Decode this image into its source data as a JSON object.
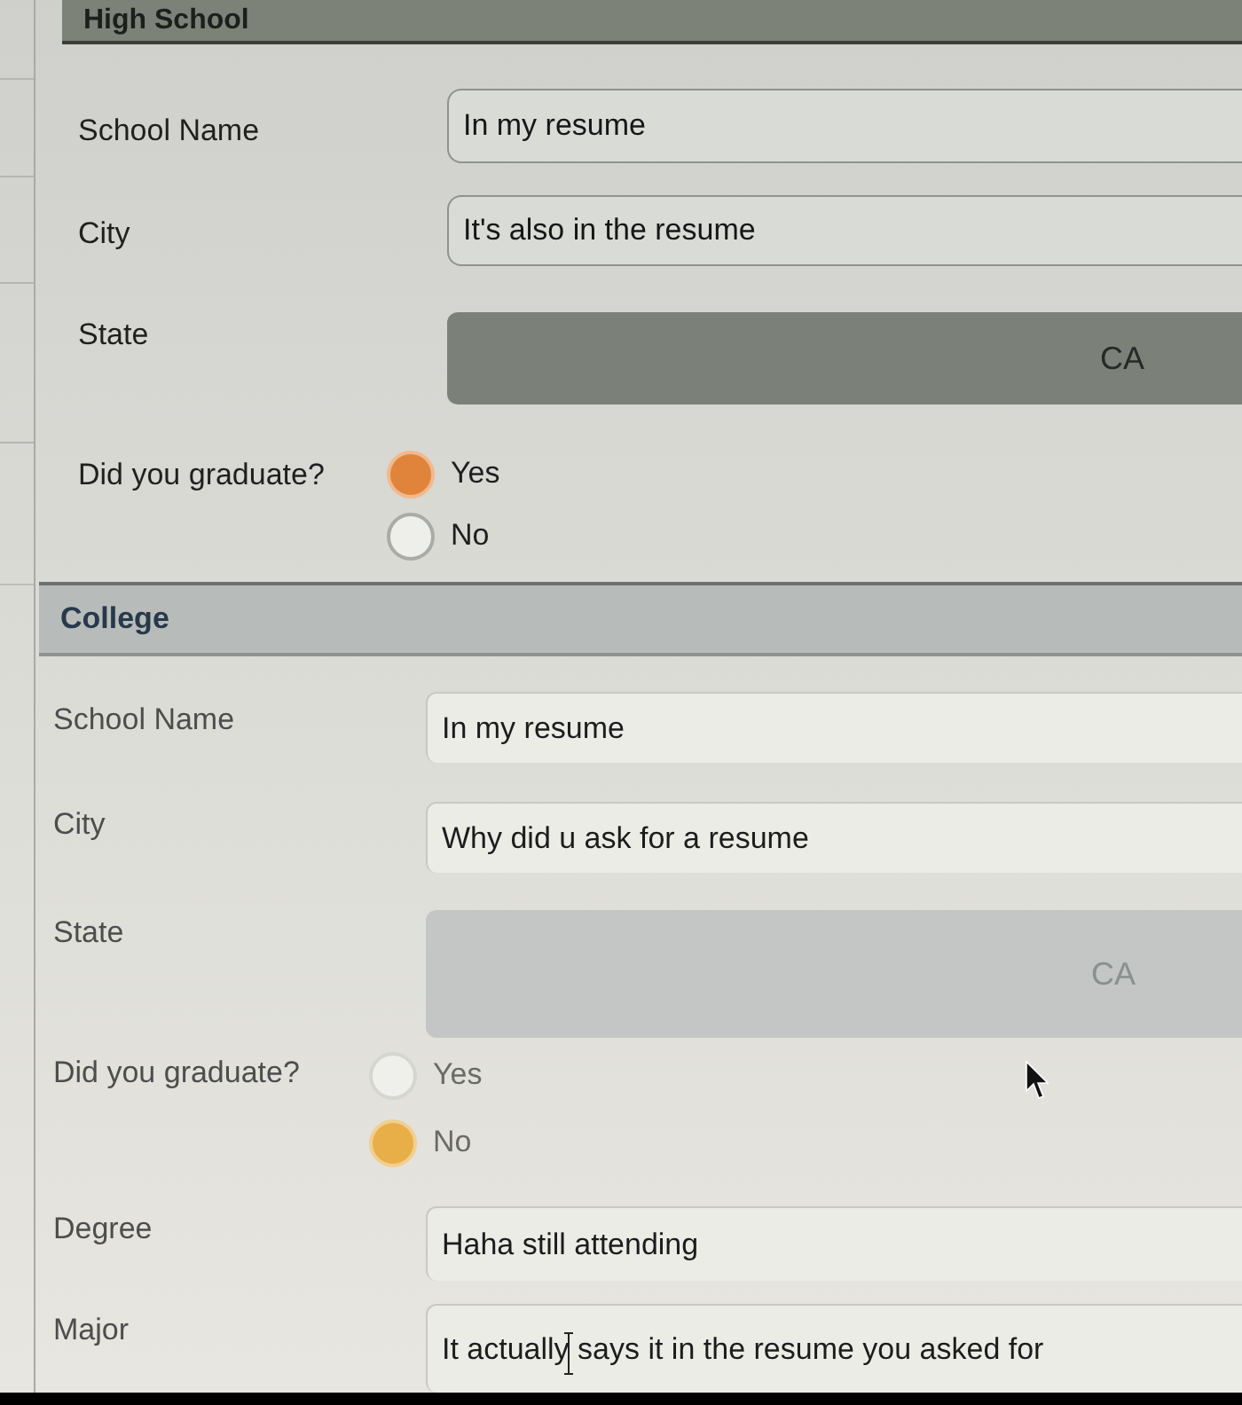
{
  "sections": [
    {
      "title": "High School",
      "fields": [
        {
          "kind": "text",
          "label": "School Name",
          "value": "In my resume"
        },
        {
          "kind": "text",
          "label": "City",
          "value": "It's also in the resume"
        },
        {
          "kind": "select",
          "label": "State",
          "value": "CA"
        },
        {
          "kind": "radio",
          "label": "Did you graduate?",
          "options": [
            {
              "label": "Yes",
              "selected": true
            },
            {
              "label": "No",
              "selected": false
            }
          ]
        }
      ]
    },
    {
      "title": "College",
      "fields": [
        {
          "kind": "text",
          "label": "School Name",
          "value": "In my resume"
        },
        {
          "kind": "text",
          "label": "City",
          "value": "Why did u ask for a resume"
        },
        {
          "kind": "select",
          "label": "State",
          "value": "CA"
        },
        {
          "kind": "radio",
          "label": "Did you graduate?",
          "options": [
            {
              "label": "Yes",
              "selected": false
            },
            {
              "label": "No",
              "selected": true
            }
          ]
        },
        {
          "kind": "text",
          "label": "Degree",
          "value": "Haha still attending"
        },
        {
          "kind": "text",
          "label": "Major",
          "value": "It actually says it in the resume you asked for"
        }
      ]
    }
  ]
}
